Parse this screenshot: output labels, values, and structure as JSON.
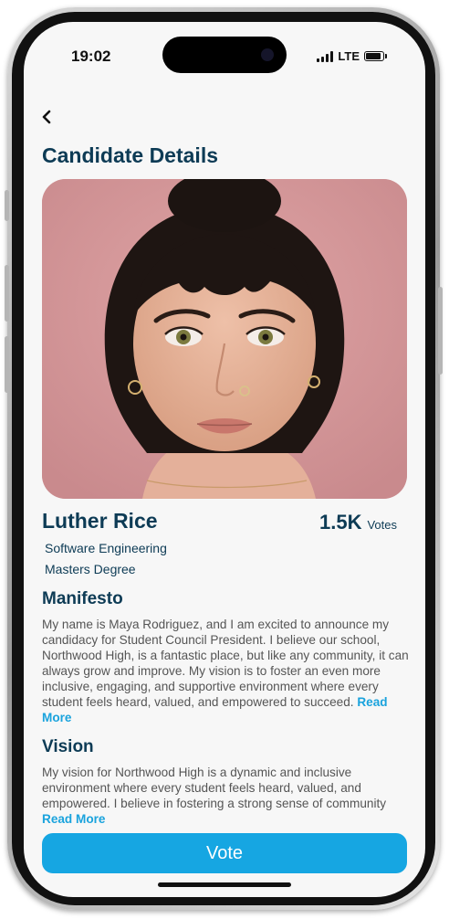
{
  "status_bar": {
    "time": "19:02",
    "network": "LTE"
  },
  "header": {
    "back_icon": "chevron-left-icon",
    "title": "Candidate Details"
  },
  "candidate": {
    "name": "Luther Rice",
    "votes_count": "1.5K",
    "votes_label": "Votes",
    "department": "Software Engineering",
    "degree": "Masters Degree"
  },
  "manifesto": {
    "heading": "Manifesto",
    "text": "My name is Maya Rodriguez, and I am excited to announce my candidacy for Student Council President. I believe our school, Northwood High, is a fantastic place, but like any community, it can always grow and improve. My vision is to foster an even more inclusive, engaging, and supportive environment where every student feels heard, valued, and empowered to succeed.",
    "read_more": "Read More"
  },
  "vision": {
    "heading": "Vision",
    "text": "My vision for Northwood High is a dynamic and inclusive environment where every student feels heard, valued, and empowered. I believe in fostering a strong sense of community",
    "read_more": "Read More"
  },
  "vote_button": {
    "label": "Vote"
  },
  "colors": {
    "heading": "#0d3b55",
    "accent": "#16a6e2",
    "link": "#1aa3dd",
    "photo_background": "#d59a9c"
  }
}
